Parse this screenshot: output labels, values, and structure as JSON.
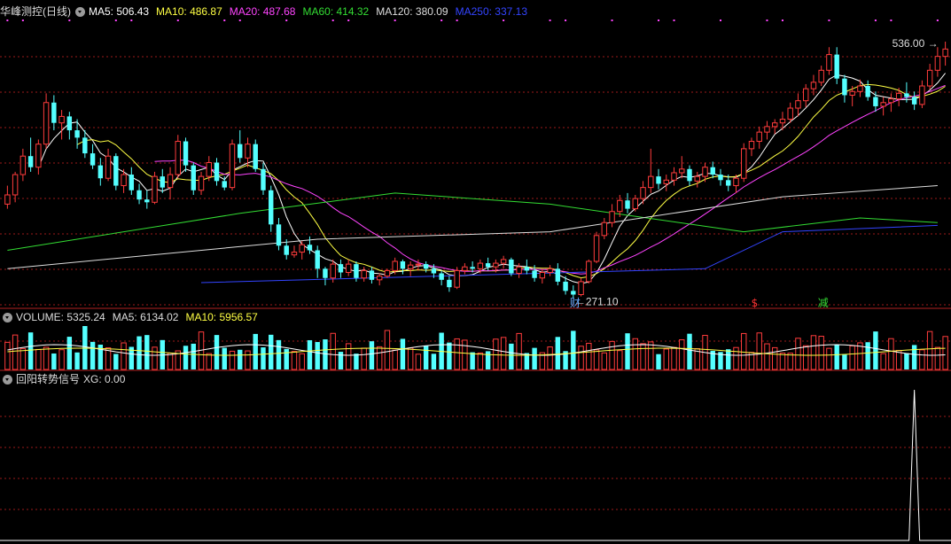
{
  "main": {
    "stock_title": "华峰测控(日线)",
    "ma": [
      {
        "label": "MA5: 506.43",
        "color": "#ffffff"
      },
      {
        "label": "MA10: 486.87",
        "color": "#ffff44"
      },
      {
        "label": "MA20: 487.68",
        "color": "#ff44ff"
      },
      {
        "label": "MA60: 414.32",
        "color": "#33dd33"
      },
      {
        "label": "MA120: 380.09",
        "color": "#dddddd"
      },
      {
        "label": "MA250: 337.13",
        "color": "#3344ff"
      }
    ],
    "high_label": "536.00",
    "low_label": "271.10",
    "markers": [
      {
        "text": "财",
        "color": "#66aaff"
      },
      {
        "text": "$",
        "color": "#ff3333"
      },
      {
        "text": "减",
        "color": "#33dd33"
      }
    ]
  },
  "volume": {
    "title": "VOLUME: 5325.24",
    "ma5": "MA5: 6134.02",
    "ma10": "MA10: 5956.57"
  },
  "indicator": {
    "title": "回阳转势信号",
    "xg": "XG: 0.00"
  },
  "colors": {
    "up": "#ff3c3c",
    "down": "#54ffff",
    "grid": "#9b1a1a",
    "background": "#000000"
  },
  "chart_data": {
    "type": "candlestick",
    "ylim": [
      250,
      560
    ],
    "ohlc": [
      [
        360,
        380,
        355,
        370
      ],
      [
        370,
        395,
        362,
        392
      ],
      [
        392,
        420,
        385,
        412
      ],
      [
        412,
        432,
        395,
        400
      ],
      [
        400,
        430,
        392,
        425
      ],
      [
        425,
        480,
        420,
        470
      ],
      [
        470,
        478,
        440,
        448
      ],
      [
        448,
        462,
        430,
        455
      ],
      [
        455,
        460,
        430,
        440
      ],
      [
        440,
        452,
        420,
        432
      ],
      [
        432,
        440,
        410,
        415
      ],
      [
        415,
        425,
        398,
        402
      ],
      [
        402,
        410,
        380,
        388
      ],
      [
        388,
        420,
        385,
        412
      ],
      [
        412,
        415,
        375,
        380
      ],
      [
        380,
        398,
        372,
        392
      ],
      [
        392,
        400,
        370,
        375
      ],
      [
        375,
        382,
        360,
        365
      ],
      [
        365,
        375,
        355,
        362
      ],
      [
        362,
        395,
        360,
        390
      ],
      [
        390,
        398,
        372,
        378
      ],
      [
        378,
        400,
        365,
        392
      ],
      [
        392,
        435,
        388,
        428
      ],
      [
        428,
        432,
        395,
        402
      ],
      [
        402,
        405,
        370,
        375
      ],
      [
        375,
        395,
        370,
        390
      ],
      [
        390,
        412,
        385,
        405
      ],
      [
        405,
        410,
        380,
        385
      ],
      [
        385,
        390,
        375,
        378
      ],
      [
        378,
        430,
        375,
        425
      ],
      [
        425,
        440,
        405,
        410
      ],
      [
        410,
        432,
        400,
        425
      ],
      [
        425,
        430,
        395,
        398
      ],
      [
        398,
        405,
        370,
        375
      ],
      [
        375,
        380,
        330,
        338
      ],
      [
        338,
        345,
        310,
        315
      ],
      [
        315,
        322,
        300,
        305
      ],
      [
        305,
        315,
        302,
        308
      ],
      [
        308,
        320,
        300,
        316
      ],
      [
        316,
        325,
        306,
        310
      ],
      [
        310,
        315,
        280,
        290
      ],
      [
        290,
        292,
        272,
        280
      ],
      [
        280,
        300,
        275,
        295
      ],
      [
        295,
        300,
        280,
        286
      ],
      [
        286,
        300,
        282,
        295
      ],
      [
        295,
        298,
        276,
        280
      ],
      [
        280,
        292,
        276,
        288
      ],
      [
        288,
        292,
        274,
        278
      ],
      [
        278,
        285,
        272,
        282
      ],
      [
        282,
        290,
        280,
        288
      ],
      [
        288,
        302,
        284,
        298
      ],
      [
        298,
        300,
        284,
        290
      ],
      [
        290,
        298,
        282,
        294
      ],
      [
        294,
        300,
        288,
        295
      ],
      [
        295,
        298,
        286,
        290
      ],
      [
        290,
        295,
        280,
        285
      ],
      [
        285,
        288,
        272,
        278
      ],
      [
        278,
        282,
        265,
        270
      ],
      [
        270,
        292,
        268,
        288
      ],
      [
        288,
        296,
        284,
        292
      ],
      [
        292,
        298,
        286,
        290
      ],
      [
        290,
        300,
        285,
        296
      ],
      [
        296,
        302,
        288,
        292
      ],
      [
        292,
        300,
        286,
        296
      ],
      [
        296,
        304,
        290,
        300
      ],
      [
        300,
        302,
        282,
        285
      ],
      [
        285,
        296,
        280,
        292
      ],
      [
        292,
        300,
        284,
        288
      ],
      [
        288,
        294,
        276,
        280
      ],
      [
        280,
        290,
        274,
        286
      ],
      [
        286,
        294,
        282,
        290
      ],
      [
        290,
        296,
        272,
        276
      ],
      [
        276,
        282,
        262,
        266
      ],
      [
        266,
        272,
        258,
        262
      ],
      [
        262,
        280,
        260,
        276
      ],
      [
        276,
        300,
        274,
        298
      ],
      [
        298,
        330,
        296,
        326
      ],
      [
        326,
        345,
        322,
        340
      ],
      [
        340,
        360,
        335,
        352
      ],
      [
        352,
        370,
        346,
        364
      ],
      [
        364,
        372,
        350,
        355
      ],
      [
        355,
        370,
        352,
        366
      ],
      [
        366,
        385,
        360,
        378
      ],
      [
        378,
        420,
        372,
        390
      ],
      [
        390,
        398,
        376,
        382
      ],
      [
        382,
        392,
        374,
        386
      ],
      [
        386,
        400,
        380,
        394
      ],
      [
        394,
        412,
        388,
        398
      ],
      [
        398,
        402,
        380,
        385
      ],
      [
        385,
        395,
        378,
        390
      ],
      [
        390,
        405,
        384,
        400
      ],
      [
        400,
        406,
        388,
        392
      ],
      [
        392,
        398,
        380,
        386
      ],
      [
        386,
        392,
        374,
        380
      ],
      [
        380,
        392,
        372,
        388
      ],
      [
        388,
        426,
        384,
        420
      ],
      [
        420,
        432,
        412,
        428
      ],
      [
        428,
        444,
        420,
        438
      ],
      [
        438,
        450,
        430,
        444
      ],
      [
        444,
        452,
        436,
        448
      ],
      [
        448,
        460,
        440,
        452
      ],
      [
        452,
        470,
        448,
        464
      ],
      [
        464,
        480,
        455,
        472
      ],
      [
        472,
        490,
        465,
        485
      ],
      [
        485,
        500,
        478,
        492
      ],
      [
        492,
        510,
        488,
        505
      ],
      [
        505,
        530,
        500,
        522
      ],
      [
        522,
        530,
        490,
        496
      ],
      [
        496,
        500,
        470,
        478
      ],
      [
        478,
        488,
        466,
        482
      ],
      [
        482,
        495,
        476,
        488
      ],
      [
        488,
        494,
        472,
        476
      ],
      [
        476,
        482,
        460,
        466
      ],
      [
        466,
        476,
        456,
        470
      ],
      [
        470,
        480,
        460,
        474
      ],
      [
        474,
        486,
        466,
        480
      ],
      [
        480,
        492,
        470,
        476
      ],
      [
        476,
        482,
        462,
        468
      ],
      [
        468,
        494,
        464,
        488
      ],
      [
        488,
        512,
        484,
        505
      ],
      [
        505,
        530,
        498,
        520
      ],
      [
        520,
        536,
        510,
        528
      ]
    ]
  }
}
